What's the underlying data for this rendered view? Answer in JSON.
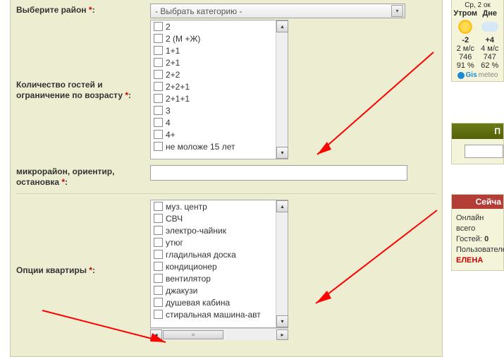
{
  "form": {
    "district": {
      "label": "Выберите район",
      "placeholder": "- Выбрать категорию -"
    },
    "guests": {
      "label": "Количество гостей и ограничение по возрасту",
      "options": [
        "2",
        "2 (М +Ж)",
        "1+1",
        "2+1",
        "2+2",
        "2+2+1",
        "2+1+1",
        "3",
        "4",
        "4+",
        "не моложе 15 лет"
      ]
    },
    "micro": {
      "label": "микрорайон, ориентир, остановка"
    },
    "opts": {
      "label": "Опции квартиры",
      "options": [
        "муз. центр",
        "СВЧ",
        "электро-чайник",
        "утюг",
        "гладильная доска",
        "кондиционер",
        "вентилятор",
        "джакузи",
        "душевая кабина",
        "стиральная машина-авт"
      ]
    }
  },
  "weather": {
    "date": "Ср, 2 ок",
    "cols": {
      "morning": {
        "label": "Утром",
        "temp": "-2",
        "wind": "2 м/с",
        "pressure": "746",
        "humidity": "91 %"
      },
      "day": {
        "label": "Дне",
        "temp": "+4",
        "wind": "4 м/с",
        "pressure": "747",
        "humidity": "62 %"
      }
    },
    "gis": {
      "blue": "Gis",
      "grey": "meteo"
    }
  },
  "search": {
    "title": "П"
  },
  "online": {
    "title": "Сейча",
    "lines": {
      "total": "Онлайн всего",
      "guests_label": "Гостей: ",
      "guests_value": "0",
      "users": "Пользователе",
      "name": "ЕЛЕНА"
    }
  }
}
